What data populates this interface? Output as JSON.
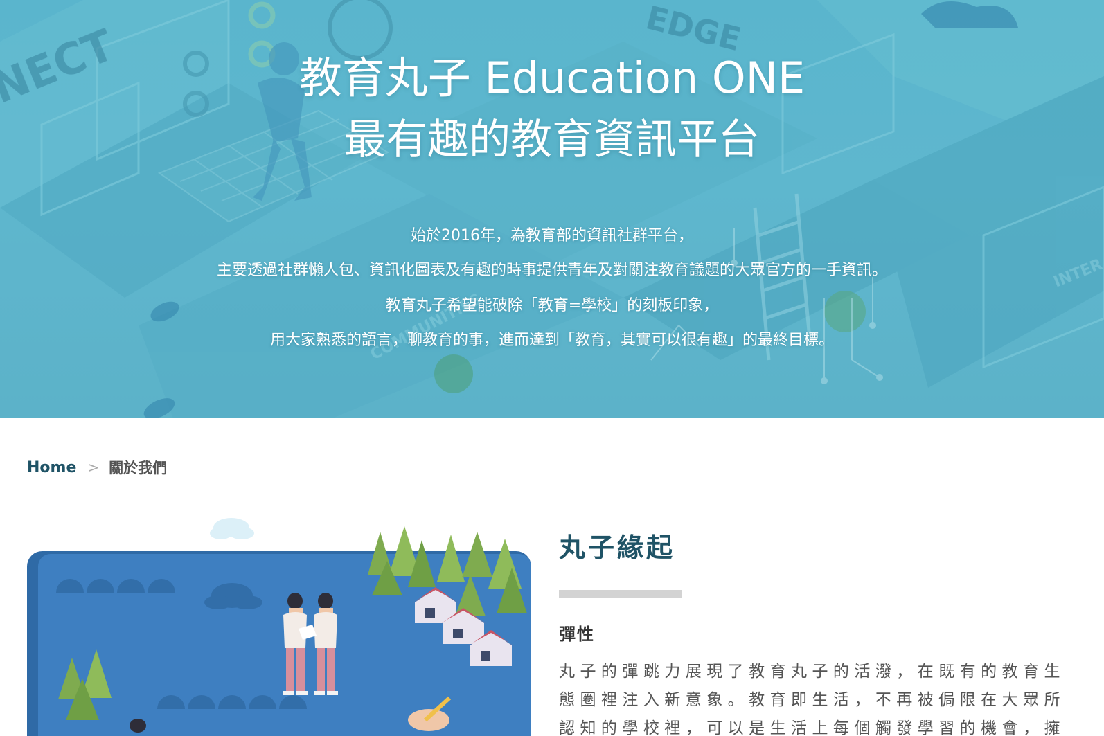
{
  "hero": {
    "title_line1": "教育丸子 Education ONE",
    "title_line2": "最有趣的教育資訊平台",
    "description": [
      "始於2016年，為教育部的資訊社群平台，",
      "主要透過社群懶人包、資訊化圖表及有趣的時事提供青年及對關注教育議題的大眾官方的一手資訊。",
      "教育丸子希望能破除「教育=學校」的刻板印象，",
      "用大家熟悉的語言，聊教育的事，進而達到「教育，其實可以很有趣」的最終目標。"
    ],
    "art_words": [
      "NECT",
      "EDGE",
      "COMMUNITIES",
      "INTER"
    ]
  },
  "breadcrumb": {
    "home": "Home",
    "separator": ">",
    "current": "關於我們"
  },
  "content": {
    "section_title": "丸子緣起",
    "sub_title": "彈性",
    "body": "丸子的彈跳力展現了教育丸子的活潑，在既有的教育生態圈裡注入新意象。教育即生活，不再被侷限在大眾所認知的學校裡，可以是生活上每個觸發學習的機會，擁有廣大的涵蓋範圍"
  },
  "colors": {
    "hero_bg": "#5cb8cf",
    "brand_dark": "#1f5366",
    "illustration_blue": "#3e7fc1",
    "title_bar": "#d3d3d3"
  }
}
